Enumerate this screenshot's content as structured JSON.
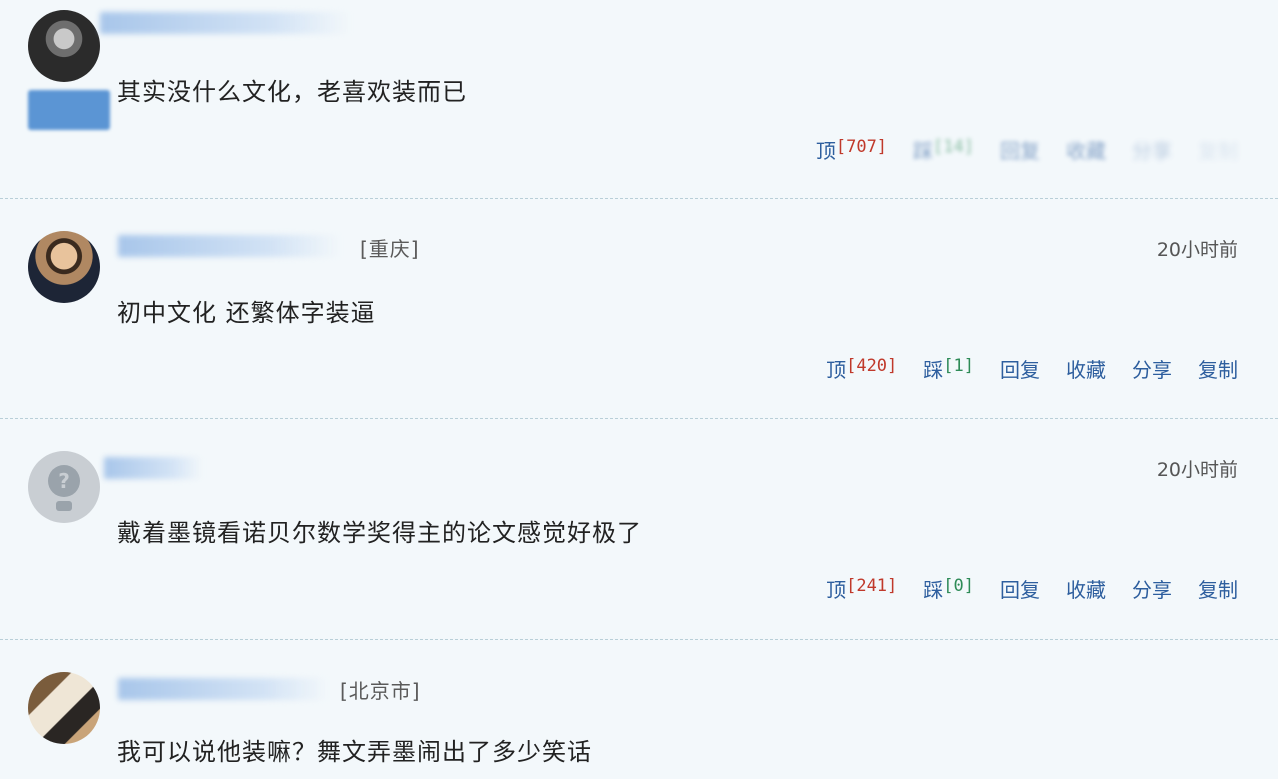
{
  "comments": [
    {
      "location": "",
      "time": "",
      "text": "其实没什么文化，老喜欢装而已",
      "actions": {
        "up_label": "顶",
        "up_count": "[707]",
        "down_label": "踩",
        "down_count": "[14]",
        "reply": "回复",
        "collect": "收藏",
        "share": "分享",
        "copy": "复制"
      }
    },
    {
      "location": "[重庆]",
      "time": "20小时前",
      "text": "初中文化  还繁体字装逼",
      "actions": {
        "up_label": "顶",
        "up_count": "[420]",
        "down_label": "踩",
        "down_count": "[1]",
        "reply": "回复",
        "collect": "收藏",
        "share": "分享",
        "copy": "复制"
      }
    },
    {
      "location": "",
      "time": "20小时前",
      "text": "戴着墨镜看诺贝尔数学奖得主的论文感觉好极了",
      "actions": {
        "up_label": "顶",
        "up_count": "[241]",
        "down_label": "踩",
        "down_count": "[0]",
        "reply": "回复",
        "collect": "收藏",
        "share": "分享",
        "copy": "复制"
      }
    },
    {
      "location": "[北京市]",
      "time": "",
      "text": "我可以说他装嘛？舞文弄墨闹出了多少笑话"
    }
  ],
  "colors": {
    "link": "#2d5e9e",
    "up_count": "#c0392b",
    "down_count": "#2e8b57",
    "background": "#f3f8fb"
  },
  "icons": {
    "default_avatar": "question-mark-avatar-icon"
  }
}
